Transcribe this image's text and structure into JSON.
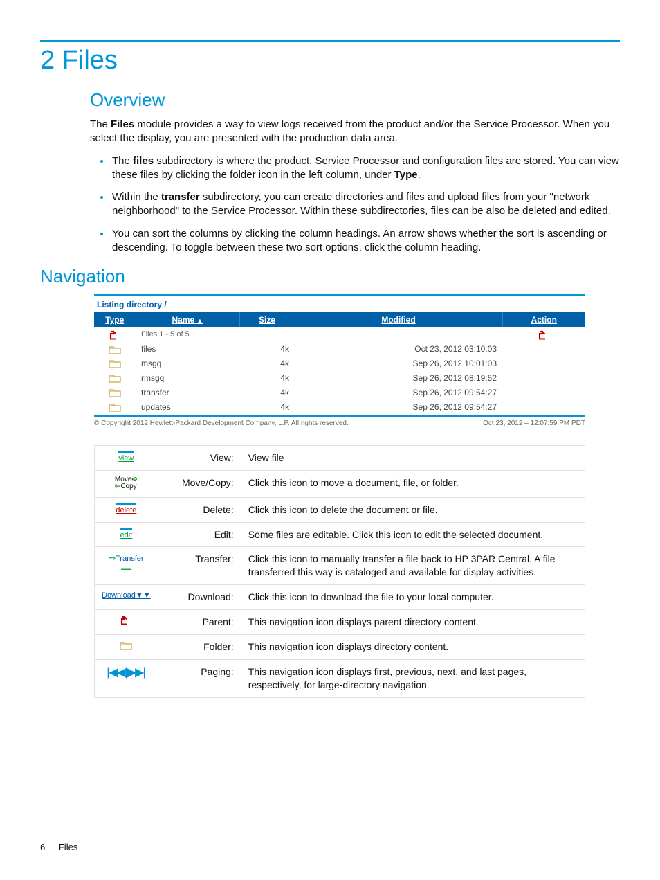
{
  "chapter_title": "2 Files",
  "overview": {
    "heading": "Overview",
    "intro_html": "The <b>Files</b> module provides a way to view logs received from the product and/or the Service Processor. When you select the display, you are presented with the production data area.",
    "bullets": [
      "The <b>files</b> subdirectory is where the product, Service Processor and configuration files are stored. You can view these files by clicking the folder icon in the left column, under <b>Type</b>.",
      "Within the <b>transfer</b> subdirectory, you can create directories and files and upload files from your \"network neighborhood\" to the Service Processor. Within these subdirectories, files can be also be deleted and edited.",
      "You can sort the columns by clicking the column headings. An arrow shows whether the sort is ascending or descending. To toggle between these two sort options, click the column heading."
    ]
  },
  "navigation_heading": "Navigation",
  "listing": {
    "title": "Listing directory /",
    "columns": {
      "type": "Type",
      "name": "Name",
      "size": "Size",
      "modified": "Modified",
      "action": "Action"
    },
    "sort_indicator": "▲",
    "pager_row_label": "Files  1 - 5 of 5",
    "rows": [
      {
        "name": "files",
        "size": "4k",
        "modified": "Oct 23, 2012 03:10:03"
      },
      {
        "name": "msgq",
        "size": "4k",
        "modified": "Sep 26, 2012 10:01:03"
      },
      {
        "name": "rmsgq",
        "size": "4k",
        "modified": "Sep 26, 2012 08:19:52"
      },
      {
        "name": "transfer",
        "size": "4k",
        "modified": "Sep 26, 2012 09:54:27"
      },
      {
        "name": "updates",
        "size": "4k",
        "modified": "Sep 26, 2012 09:54:27"
      }
    ],
    "copyright": "© Copyright 2012 Hewlett-Packard Development Company, L.P.   All rights reserved.",
    "timestamp": "Oct 23, 2012 – 12:07:59 PM PDT"
  },
  "legend": [
    {
      "icon": "view",
      "icon_text": "view",
      "label": "View:",
      "desc": "View file"
    },
    {
      "icon": "movecopy",
      "icon_text": "Move⇨\n⇦Copy",
      "label": "Move/Copy:",
      "desc": "Click this icon to move a document, file, or folder."
    },
    {
      "icon": "delete",
      "icon_text": "delete",
      "label": "Delete:",
      "desc": "Click this icon to delete the document or file."
    },
    {
      "icon": "edit",
      "icon_text": "edit",
      "label": "Edit:",
      "desc": "Some files are editable. Click this icon to edit the selected document."
    },
    {
      "icon": "transfer",
      "icon_text": "Transfer",
      "label": "Transfer:",
      "desc": "Click this icon to manually transfer a file back to HP 3PAR Central. A file transferred this way is cataloged and available for display activities."
    },
    {
      "icon": "download",
      "icon_text": "Download",
      "label": "Download:",
      "desc": "Click this icon to download the file to your local computer."
    },
    {
      "icon": "parent",
      "icon_text": "",
      "label": "Parent:",
      "desc": "This navigation icon displays parent directory content."
    },
    {
      "icon": "folder",
      "icon_text": "",
      "label": "Folder:",
      "desc": "This navigation icon displays directory content."
    },
    {
      "icon": "paging",
      "icon_text": "|◀◀|▶▶|",
      "label": "Paging:",
      "desc": "This navigation icon displays first, previous, next, and last pages, respectively, for large-directory navigation."
    }
  ],
  "footer": {
    "page_number": "6",
    "section": "Files"
  }
}
